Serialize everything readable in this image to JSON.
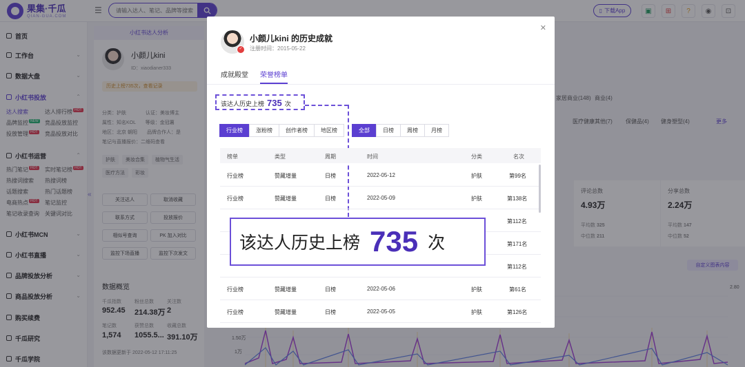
{
  "header": {
    "logo_name": "果集·千瓜",
    "logo_sub": "QIAN-GUA.COM",
    "search_placeholder": "请输入达人、笔记、品牌等搜索",
    "download_label": "下载App",
    "question_label": "?"
  },
  "sidebar": {
    "items": [
      {
        "label": "首页"
      },
      {
        "label": "工作台"
      },
      {
        "label": "数据大盘"
      },
      {
        "label": "小红书投放"
      },
      {
        "label": "小红书运营"
      },
      {
        "label": "小红书MCN"
      },
      {
        "label": "小红书直播"
      },
      {
        "label": "品牌投放分析"
      },
      {
        "label": "商品投放分析"
      },
      {
        "label": "购买续费"
      },
      {
        "label": "千瓜研究"
      },
      {
        "label": "千瓜学院"
      }
    ],
    "investment_subs": [
      "达人搜索",
      "达人排行榜",
      "品牌监控",
      "竞品投放监控",
      "投放管理",
      "竞品投放对比"
    ],
    "operation_subs": [
      "热门笔记",
      "实时笔记榜",
      "热搜词搜索",
      "热搜词榜",
      "话题搜索",
      "热门话题榜",
      "电商热点",
      "笔记监控",
      "笔记收录查询",
      "关键词对比"
    ],
    "hot_badge": "HOT",
    "new_badge": "NEW"
  },
  "profile": {
    "panel_title": "小红书达人分析",
    "name": "小颜儿kini",
    "id": "ID：xiaodianer333",
    "history": "历史上榜735次，查看记录",
    "meta": [
      "分类：护肤　　　　认证：美妆博主",
      "属性：知名KOL　　等级：金冠薯",
      "地区：北京 朝阳　　品牌合作人：是",
      "笔记与直播报价：二维码查看"
    ],
    "tags_row1": [
      "护肤",
      "美妆合集",
      "植物气生活"
    ],
    "tags_row2": [
      "医疗方法",
      "彩妆"
    ],
    "buttons": [
      "关注达人",
      "取消收藏",
      "联系方式",
      "投放报价",
      "相似号查询",
      "PK 加入对比",
      "监控下场直播",
      "监控下次发文"
    ],
    "overview_title": "数据概览",
    "stats": [
      {
        "label": "千瓜指数",
        "value": "952.45"
      },
      {
        "label": "粉丝总数",
        "value": "214.38万"
      },
      {
        "label": "关注数",
        "value": "2"
      },
      {
        "label": "笔记数",
        "value": "1,574"
      },
      {
        "label": "获赞总数",
        "value": "1055.5..."
      },
      {
        "label": "收藏总数",
        "value": "391.10万"
      }
    ],
    "footer_text": "该数据更新于 2022-05-12 17:11:25"
  },
  "background": {
    "cats_row1": [
      "家居商业(148)",
      "商业(4)"
    ],
    "cats_row2": [
      "医疗健康其他(7)",
      "保健品(4)",
      "健身塑型(4)",
      "更多"
    ],
    "cards": [
      {
        "label": "评论总数",
        "value": "4.93万",
        "avg_label": "平均数",
        "avg": "325",
        "mid_label": "中位数",
        "mid": "211"
      },
      {
        "label": "分享总数",
        "value": "2.24万",
        "avg_label": "平均数",
        "avg": "147",
        "mid_label": "中位数",
        "mid": "52"
      }
    ],
    "custom_button": "自定义图表内容",
    "y_labels": [
      "1.50万",
      "1万"
    ],
    "right_labels": [
      "2.80"
    ]
  },
  "modal": {
    "title": "小颜儿kini 的历史成就",
    "register": "注册时间：2015-05-22",
    "tabs": [
      "成就殿堂",
      "荣誉榜单"
    ],
    "small_label": "该达人历史上榜",
    "count": "735",
    "unit": "次",
    "segment_left": [
      "行业榜",
      "涨粉榜",
      "创作者榜",
      "地区榜"
    ],
    "segment_right": [
      "全部",
      "日榜",
      "周榜",
      "月榜"
    ],
    "columns": [
      "榜单",
      "类型",
      "周期",
      "时间",
      "分类",
      "名次"
    ],
    "rows": [
      [
        "行业榜",
        "赞藏增量",
        "日榜",
        "2022-05-12",
        "护肤",
        "第99名"
      ],
      [
        "行业榜",
        "赞藏增量",
        "日榜",
        "2022-05-09",
        "护肤",
        "第138名"
      ],
      [
        "",
        "",
        "",
        "",
        "",
        "第112名"
      ],
      [
        "",
        "",
        "",
        "",
        "",
        "第171名"
      ],
      [
        "",
        "",
        "",
        "",
        "",
        "第112名"
      ],
      [
        "行业榜",
        "赞藏增量",
        "日榜",
        "2022-05-06",
        "护肤",
        "第61名"
      ],
      [
        "行业榜",
        "赞藏增量",
        "日榜",
        "2022-05-05",
        "护肤",
        "第126名"
      ]
    ],
    "big_label": "该达人历史上榜",
    "big_count": "735",
    "big_unit": "次"
  }
}
